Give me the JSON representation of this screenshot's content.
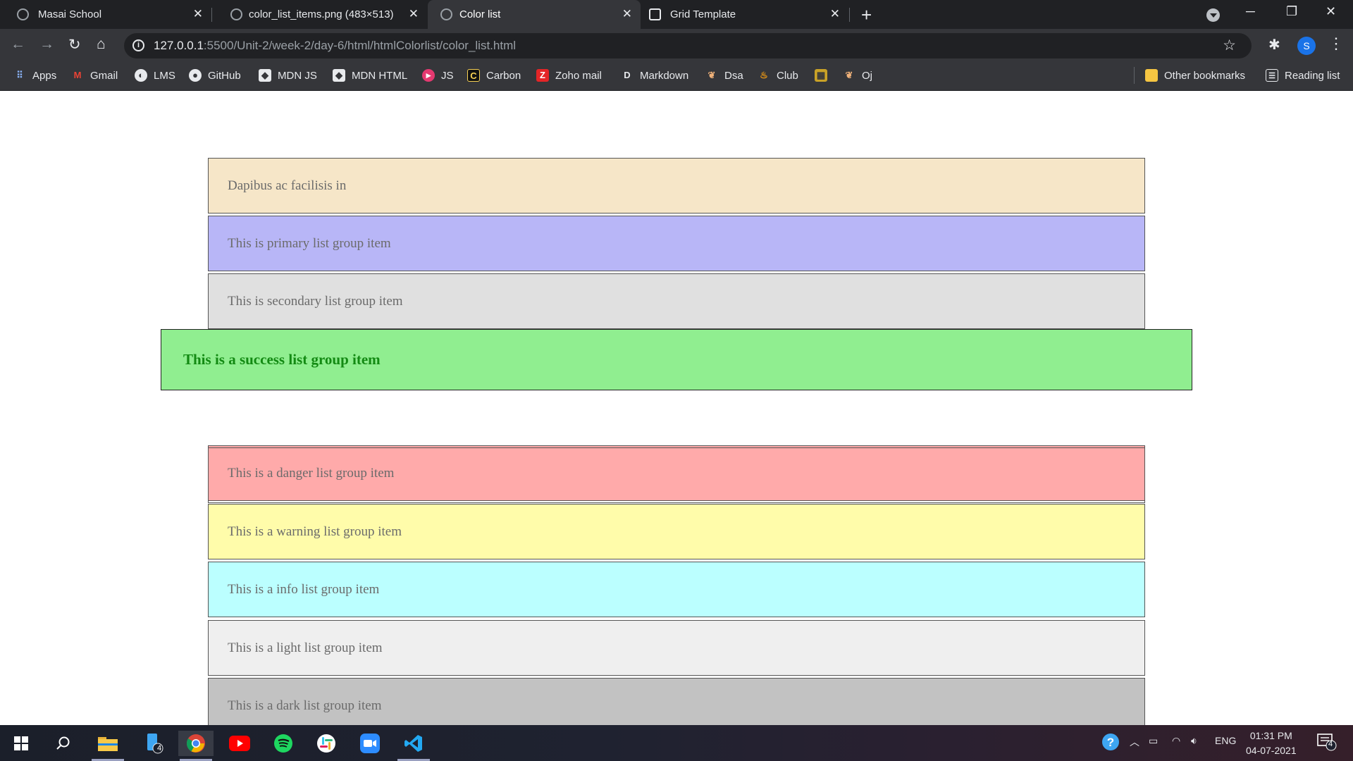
{
  "browser": {
    "tabs": [
      {
        "title": "Masai School",
        "active": false
      },
      {
        "title": "color_list_items.png (483×513)",
        "active": false
      },
      {
        "title": "Color list",
        "active": true
      },
      {
        "title": "Grid Template",
        "active": false
      }
    ],
    "url_host": "127.0.0.1",
    "url_rest": ":5500/Unit-2/week-2/day-6/html/htmlColorlist/color_list.html",
    "profile_initial": "S",
    "bookmarks": [
      {
        "label": "Apps",
        "icon": "apps-grid-icon"
      },
      {
        "label": "Gmail",
        "icon": "gmail-icon"
      },
      {
        "label": "LMS",
        "icon": "globe-icon"
      },
      {
        "label": "GitHub",
        "icon": "github-icon"
      },
      {
        "label": "MDN JS",
        "icon": "mdn-icon"
      },
      {
        "label": "MDN HTML",
        "icon": "mdn-icon"
      },
      {
        "label": "JS",
        "icon": "play-icon"
      },
      {
        "label": "Carbon",
        "icon": "carbon-icon"
      },
      {
        "label": "Zoho mail",
        "icon": "zoho-icon"
      },
      {
        "label": "Markdown",
        "icon": "markdown-icon"
      },
      {
        "label": "Dsa",
        "icon": "code-icon"
      },
      {
        "label": "Club",
        "icon": "flame-icon"
      },
      {
        "label": "",
        "icon": "gfg-icon"
      },
      {
        "label": "Oj",
        "icon": "code-icon"
      }
    ],
    "other_bookmarks": "Other bookmarks",
    "reading_list": "Reading list"
  },
  "list_items": [
    {
      "text": "Dapibus ac facilisis in",
      "variant": "default",
      "bg": "#f6e6c8"
    },
    {
      "text": "This is primary list group item",
      "variant": "primary",
      "bg": "#b8b6f7"
    },
    {
      "text": "This is secondary list group item",
      "variant": "secondary",
      "bg": "#e0e0e0"
    },
    {
      "text": "This is a success list group item",
      "variant": "success",
      "bg": "#90ee90",
      "color": "#138a13"
    },
    {
      "text": "This is a danger list group item",
      "variant": "danger",
      "bg": "#ffaaaa"
    },
    {
      "text": "This is a warning list group item",
      "variant": "warning",
      "bg": "#fffcaa"
    },
    {
      "text": "This is a info list group item",
      "variant": "info",
      "bg": "#bbffff"
    },
    {
      "text": "This is a light list group item",
      "variant": "light",
      "bg": "#efefef"
    },
    {
      "text": "This is a dark list group item",
      "variant": "dark",
      "bg": "#c2c2c2"
    }
  ],
  "taskbar": {
    "badge_count": "4",
    "language": "ENG",
    "time": "01:31 PM",
    "date": "04-07-2021",
    "notification_count": "4"
  }
}
